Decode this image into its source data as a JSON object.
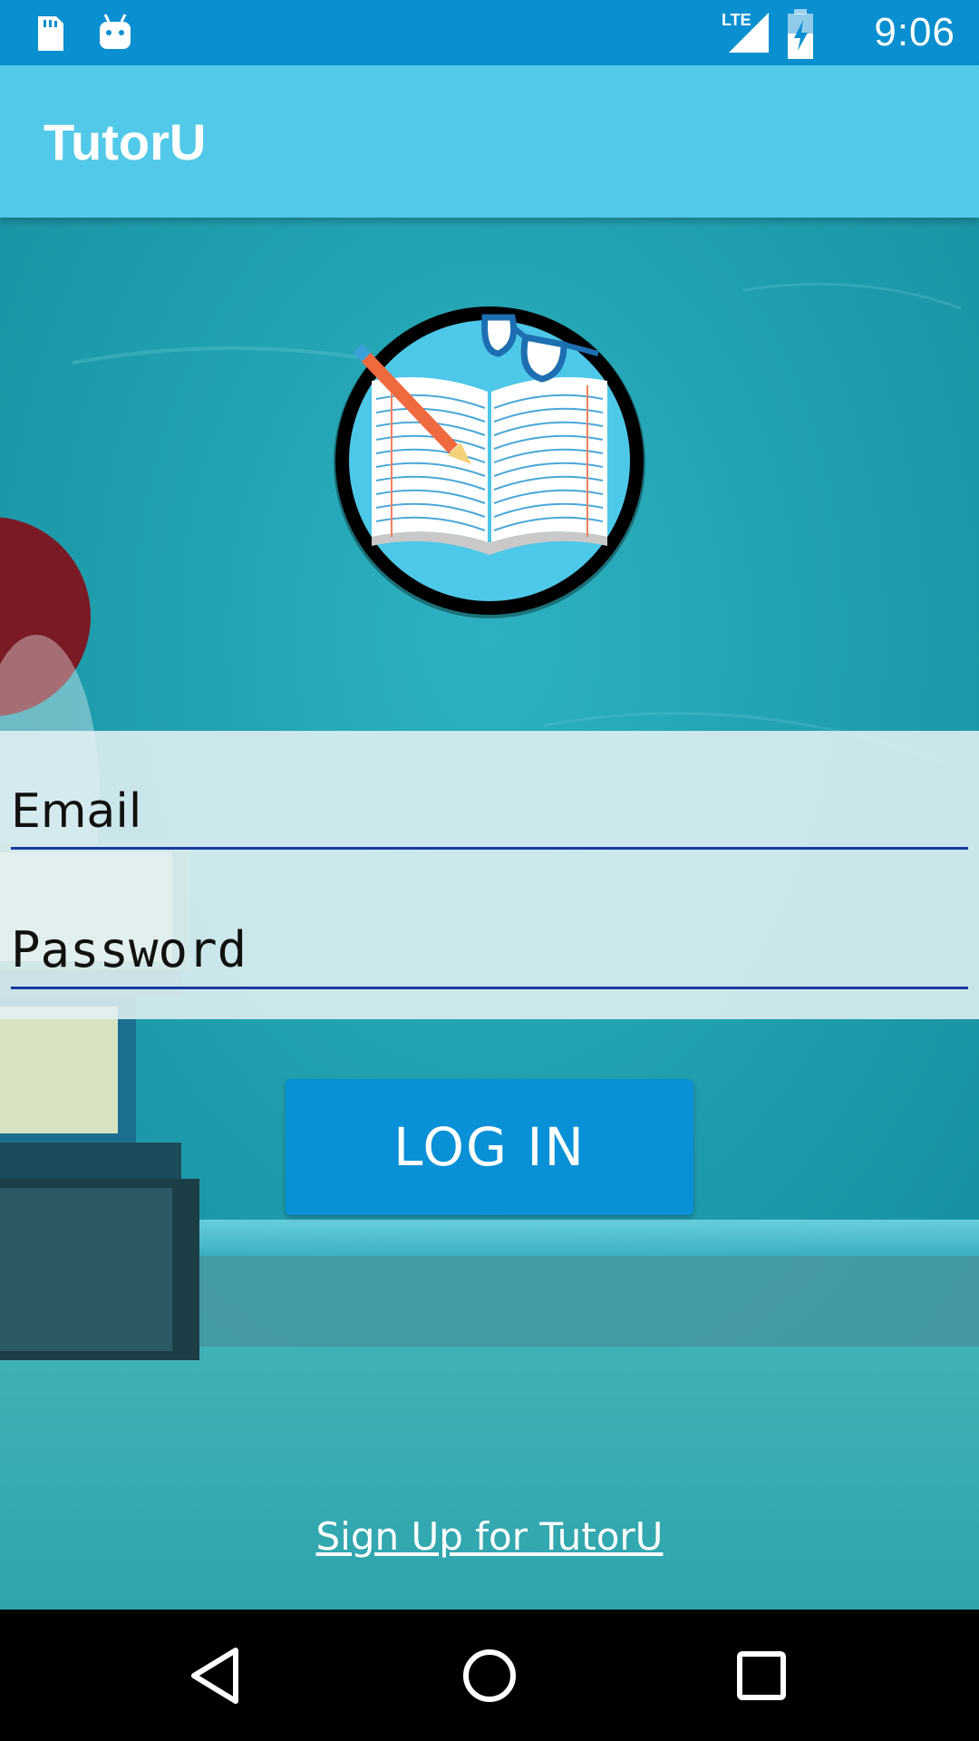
{
  "status_bar": {
    "time": "9:06",
    "network": "LTE",
    "icons": [
      "sd-card-icon",
      "android-debug-icon",
      "lte-signal-icon",
      "battery-charging-icon"
    ]
  },
  "app_bar": {
    "title": "TutorU",
    "color": "#52c9e8"
  },
  "logo": {
    "icon": "open-book-with-pencil-and-glasses-logo"
  },
  "login_form": {
    "email_placeholder": "Email",
    "password_placeholder": "Password",
    "underline_color": "#1a3aa0"
  },
  "login_button": {
    "label": "LOG IN",
    "color": "#0891d6"
  },
  "signup_link": {
    "label": "Sign Up for TutorU"
  },
  "nav_bar": {
    "buttons": [
      "back-icon",
      "home-icon",
      "recents-icon"
    ]
  }
}
